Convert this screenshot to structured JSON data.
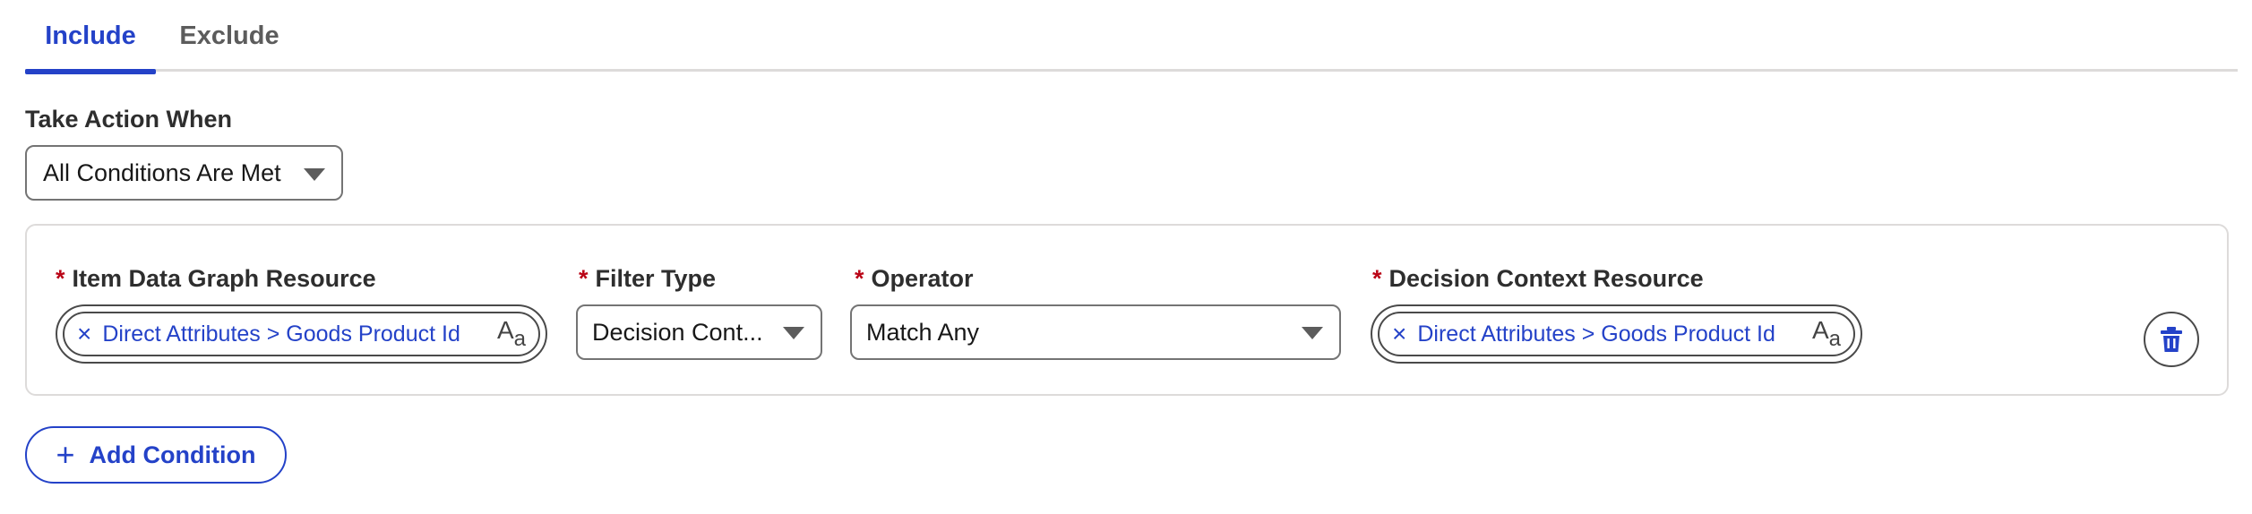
{
  "tabs": [
    {
      "label": "Include",
      "active": true
    },
    {
      "label": "Exclude",
      "active": false
    }
  ],
  "take_action": {
    "label": "Take Action When",
    "value": "All Conditions Are Met"
  },
  "condition": {
    "item_resource": {
      "required_mark": "*",
      "label": "Item Data Graph Resource",
      "value": "Direct Attributes > Goods Product Id",
      "remove_glyph": "×",
      "type_icon": "text-type-icon"
    },
    "filter_type": {
      "required_mark": "*",
      "label": "Filter Type",
      "value": "Decision Cont..."
    },
    "operator": {
      "required_mark": "*",
      "label": "Operator",
      "value": "Match Any"
    },
    "context_resource": {
      "required_mark": "*",
      "label": "Decision Context Resource",
      "value": "Direct Attributes > Goods Product Id",
      "remove_glyph": "×",
      "type_icon": "text-type-icon"
    },
    "delete_icon": "trash-icon"
  },
  "add_condition": {
    "label": "Add Condition",
    "icon": "plus-icon"
  },
  "colors": {
    "brand": "#2442c8",
    "required": "#ba0517",
    "border": "#dddbda"
  }
}
